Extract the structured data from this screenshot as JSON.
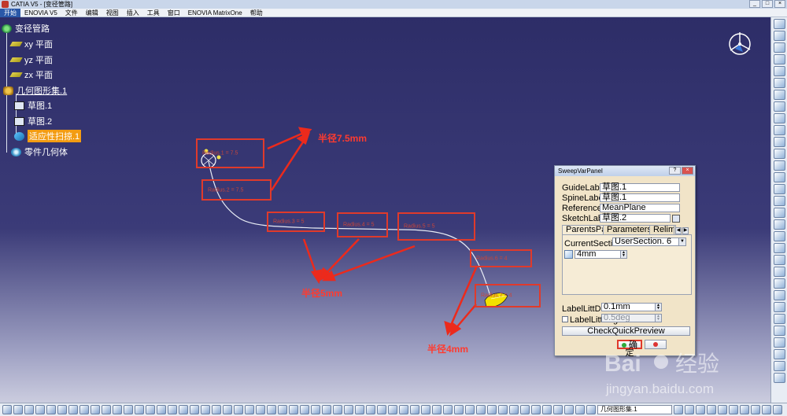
{
  "window": {
    "title": "CATIA V5 - [变径管路]",
    "buttons": [
      "_",
      "□",
      "×"
    ]
  },
  "menu": [
    "开始",
    "ENOVIA V5",
    "文件",
    "编辑",
    "视图",
    "插入",
    "工具",
    "窗口",
    "ENOVIA MatrixOne",
    "帮助"
  ],
  "tree": {
    "root": "变径管路",
    "planes": [
      "xy 平面",
      "yz 平面",
      "zx 平面"
    ],
    "geom_set": "几何图形集.1",
    "sketch1": "草图.1",
    "sketch2": "草图.2",
    "sweep": "适应性扫掠.1",
    "body": "零件几何体"
  },
  "annotations": {
    "r75": "半径7.5mm",
    "r5": "半径5mm",
    "r4": "半径4mm"
  },
  "dialog": {
    "title": "SweepVarPanel",
    "guide_label": "GuideLabel",
    "guide_value": "草图.1",
    "spine_label": "SpineLabel",
    "spine_value": "草图.1",
    "reference_label": "ReferenceLabel",
    "reference_value": "MeanPlane",
    "sketch_label": "SketchLabel",
    "sketch_value": "草图.2",
    "tabs": [
      "ParentsPage",
      "ParametersPage",
      "Relimitat"
    ],
    "current_section_label": "CurrentSectionLabel",
    "current_section_value": "UserSection. 6",
    "param_value": "4mm",
    "label_litt_dev": "LabelLittDev",
    "litt_dev_value": "0.1mm",
    "label_litt_ang": "LabelLittAng",
    "litt_ang_value": "0.5deg",
    "preview_button": "CheckQuickPreview",
    "ok_button": "确定"
  },
  "bottom_toolbar": {
    "geom_set_select": "几何图形集.1"
  },
  "watermark": {
    "brand": "Bai 经验",
    "url": "jingyan.baidu.com"
  }
}
